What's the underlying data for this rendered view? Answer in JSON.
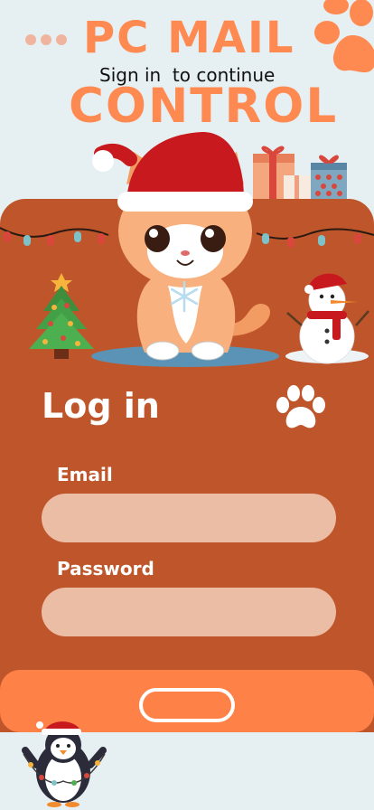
{
  "header": {
    "title_line1": "PC MAIL",
    "subtitle": "Sign in  to continue",
    "title_line2": "CONTROL"
  },
  "login": {
    "heading": "Log in",
    "email_label": "Email",
    "email_value": "",
    "password_label": "Password",
    "password_value": "",
    "submit_label": ""
  },
  "colors": {
    "background": "#e6eff1",
    "accent_orange": "#fe8a52",
    "card_brown": "#bf562b",
    "field_fill": "#ecbda5",
    "bottom_bar": "#fe8147"
  },
  "icons": {
    "decor_top_right": "paw-print-icon",
    "heading_icon": "paw-print-icon",
    "illustrations": [
      "christmas-lights",
      "gift-boxes",
      "christmas-tree",
      "kitten-santa-hat",
      "snowman",
      "penguin"
    ]
  }
}
